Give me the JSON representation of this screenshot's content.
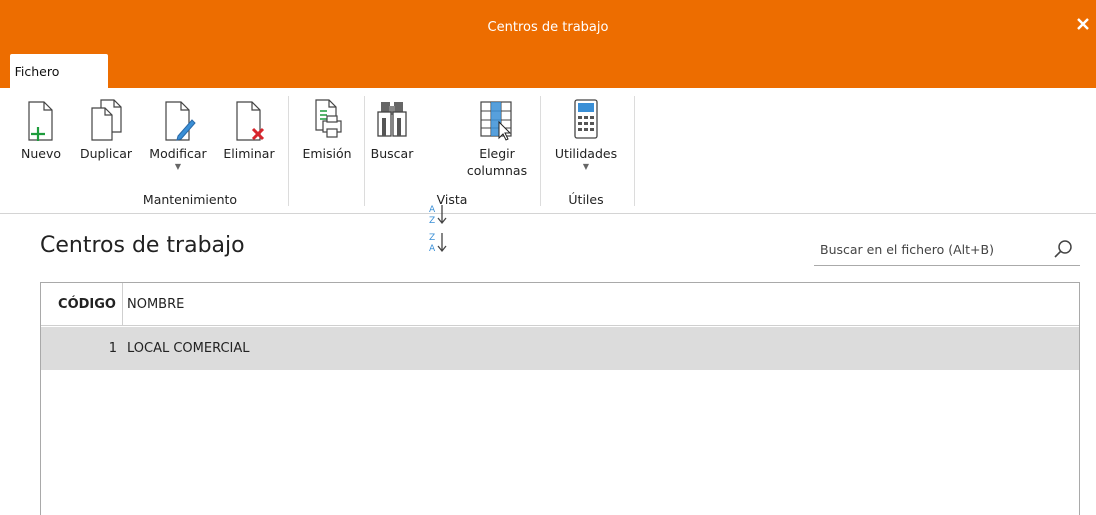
{
  "window": {
    "title": "Centros de trabajo",
    "close_glyph": "✕"
  },
  "ribbon_tabs": [
    {
      "label": "Fichero",
      "active": true
    }
  ],
  "ribbon": {
    "groups": [
      {
        "label": "Mantenimiento",
        "buttons": [
          {
            "label": "Nuevo",
            "icon": "new-document-icon"
          },
          {
            "label": "Duplicar",
            "icon": "duplicate-icon"
          },
          {
            "label": "Modificar",
            "icon": "edit-document-icon",
            "dropdown": true
          },
          {
            "label": "Eliminar",
            "icon": "delete-document-icon"
          }
        ]
      },
      {
        "label": "",
        "buttons": [
          {
            "label": "Emisión",
            "icon": "print-icon"
          }
        ]
      },
      {
        "label": "Vista",
        "buttons": [
          {
            "label": "Buscar",
            "icon": "binoculars-icon"
          },
          {
            "label": "sort-ascending",
            "icon": "sort-az-icon"
          },
          {
            "label": "sort-descending",
            "icon": "sort-za-icon"
          },
          {
            "label_line1": "Elegir",
            "label_line2": "columnas",
            "icon": "choose-columns-icon"
          }
        ]
      },
      {
        "label": "Útiles",
        "buttons": [
          {
            "label": "Utilidades",
            "icon": "calculator-icon",
            "dropdown": true
          }
        ]
      }
    ]
  },
  "page": {
    "title": "Centros de trabajo",
    "search_placeholder": "Buscar en el fichero (Alt+B)"
  },
  "table": {
    "columns": [
      "CÓDIGO",
      "NOMBRE"
    ],
    "rows": [
      {
        "codigo": "1",
        "nombre": "LOCAL COMERCIAL",
        "selected": true
      }
    ]
  },
  "colors": {
    "accent": "#ED6D00",
    "selected_row": "#DCDCDC"
  }
}
